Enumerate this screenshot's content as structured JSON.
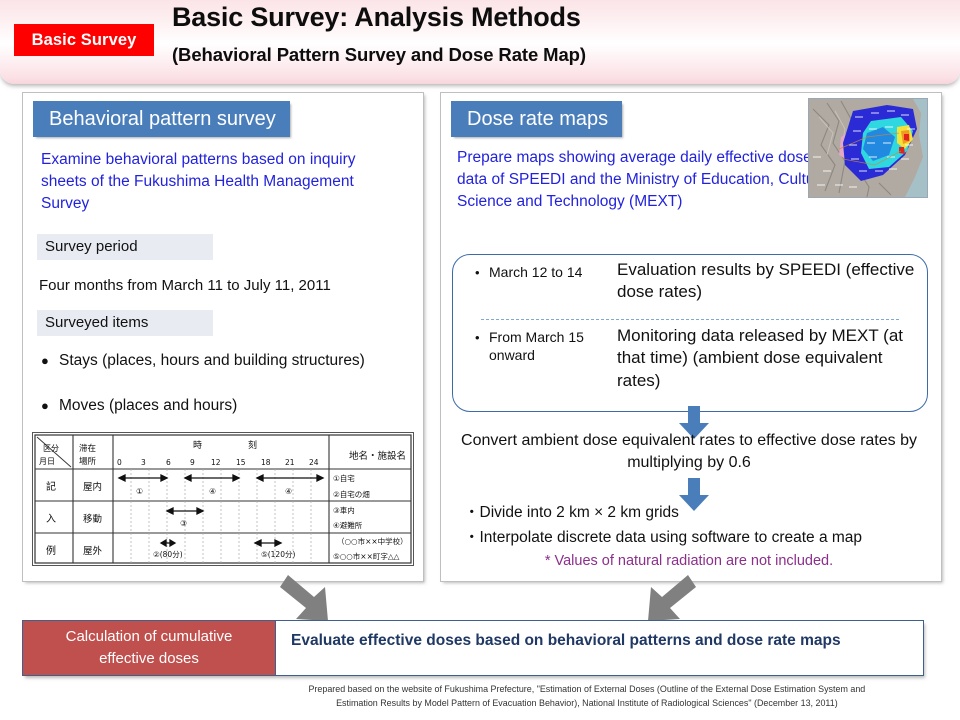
{
  "banner": {
    "tag": "Basic Survey",
    "title": "Basic Survey: Analysis Methods",
    "subtitle": "(Behavioral Pattern Survey and Dose Rate Map)"
  },
  "left_panel": {
    "heading": "Behavioral pattern survey",
    "intro": "Examine behavioral patterns based on inquiry sheets of the Fukushima Health Management Survey",
    "period_label": "Survey period",
    "period_value": "Four months from March 11 to July 11, 2011",
    "items_label": "Surveyed items",
    "items": [
      "Stays (places, hours and building structures)",
      "Moves (places and hours)"
    ],
    "form": {
      "col_header_1a": "区分",
      "col_header_1b": "月日",
      "col_header_2a": "滞在",
      "col_header_2b": "場所",
      "time_label_1": "時",
      "time_label_2": "刻",
      "time_ticks": [
        "0",
        "3",
        "6",
        "9",
        "12",
        "15",
        "18",
        "21",
        "24"
      ],
      "col_header_right": "地名・施設名",
      "rows": [
        {
          "c1": "記",
          "c2": "屋内"
        },
        {
          "c1": "入",
          "c2": "移動"
        },
        {
          "c1": "例",
          "c2": "屋外"
        }
      ],
      "legend": [
        "①自宅",
        "②自宅の畑",
        "③車内",
        "④避難所",
        "（○○市××中学校）",
        "⑤○○市××町字△△"
      ],
      "markers": [
        "①",
        "④",
        "④",
        "③",
        "②(80分)",
        "⑤(120分)"
      ]
    }
  },
  "right_panel": {
    "heading": "Dose rate maps",
    "intro": "Prepare maps showing average daily effective dose rates based on data of SPEEDI and the Ministry of Education, Culture, Sports, Science and Technology (MEXT)",
    "map_thumbnail_alt": "dose-rate-map-thumbnail",
    "callout": {
      "bullet": "•",
      "row1_period": "March 12 to 14",
      "row1_desc": "Evaluation results by SPEEDI (effective dose rates)",
      "row2_period": "From March 15 onward",
      "row2_desc": "Monitoring data released by MEXT (at that time) (ambient dose equivalent rates)"
    },
    "convert_text": "Convert ambient dose equivalent rates to effective dose rates by multiplying by 0.6",
    "steps": [
      "・Divide into 2 km × 2 km grids",
      "・Interpolate discrete data using software to create a map"
    ],
    "note": "* Values of natural radiation are not included."
  },
  "bottom": {
    "red_line1": "Calculation of cumulative",
    "red_line2": "effective doses",
    "text": "Evaluate effective doses based on behavioral patterns and dose rate maps"
  },
  "footer": {
    "line1": "Prepared based on the website of Fukushima Prefecture, \"Estimation of External Doses (Outline of the External Dose Estimation System and",
    "line2": "Estimation Results by Model Pattern of Evacuation Behavior), National Institute of Radiological Sciences\" (December 13, 2011)"
  },
  "colors": {
    "tag_red": "#fe0000",
    "panel_head_blue": "#4a7ebb",
    "blue_text": "#2222dd",
    "callout_border": "#3c6ca8",
    "red_box": "#c0504d",
    "bottom_text_navy": "#1f3864",
    "note_purple": "#8c2f8c",
    "grey_arrow": "#808080"
  }
}
